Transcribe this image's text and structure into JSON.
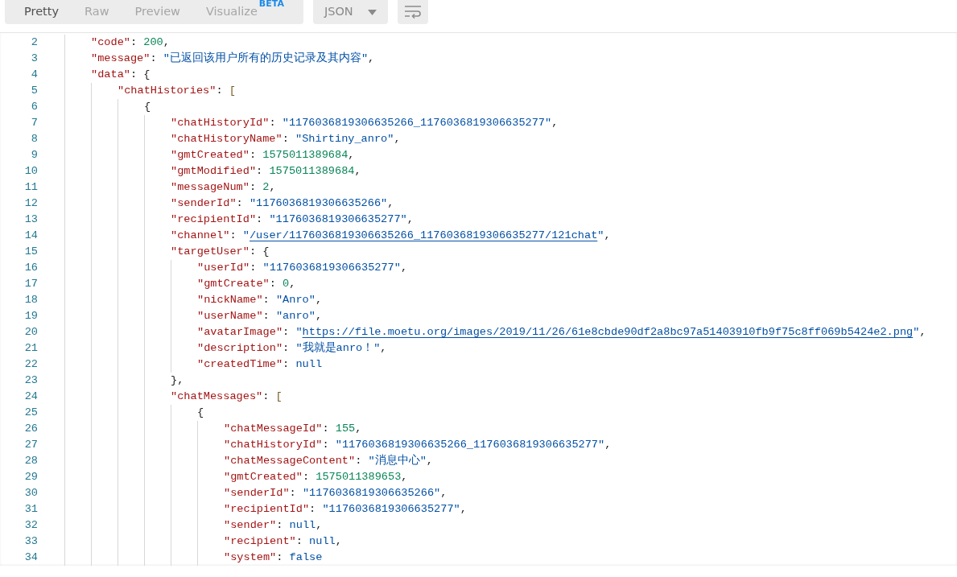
{
  "toolbar": {
    "tabs": [
      {
        "label": "Pretty",
        "selected": true
      },
      {
        "label": "Raw",
        "selected": false
      },
      {
        "label": "Preview",
        "selected": false
      },
      {
        "label": "Visualize",
        "selected": false,
        "badge": "BETA"
      }
    ],
    "format": "JSON"
  },
  "lines": [
    {
      "number": "2",
      "key": "\"code\"",
      "colon": ":",
      "value": "200",
      "kind": "number",
      "tail": ","
    },
    {
      "number": "3",
      "key": "\"message\"",
      "colon": ":",
      "value": "\"已返回该用户所有的历史记录及其内容\"",
      "kind": "string",
      "tail": ","
    },
    {
      "number": "4",
      "key": "\"data\"",
      "colon": ":",
      "value": "{",
      "kind": "punct",
      "children": [
        {
          "number": "5",
          "key": "\"chatHistories\"",
          "colon": ":",
          "value": "[",
          "kind": "bracket",
          "children": [
            {
              "number": "6",
              "value": "{",
              "kind": "punct",
              "children": [
                {
                  "number": "7",
                  "key": "\"chatHistoryId\"",
                  "colon": ":",
                  "value": "\"1176036819306635266_1176036819306635277\"",
                  "kind": "string",
                  "tail": ","
                },
                {
                  "number": "8",
                  "key": "\"chatHistoryName\"",
                  "colon": ":",
                  "value": "\"Shirtiny_anro\"",
                  "kind": "string",
                  "tail": ","
                },
                {
                  "number": "9",
                  "key": "\"gmtCreated\"",
                  "colon": ":",
                  "value": "1575011389684",
                  "kind": "number",
                  "tail": ","
                },
                {
                  "number": "10",
                  "key": "\"gmtModified\"",
                  "colon": ":",
                  "value": "1575011389684",
                  "kind": "number",
                  "tail": ","
                },
                {
                  "number": "11",
                  "key": "\"messageNum\"",
                  "colon": ":",
                  "value": "2",
                  "kind": "number",
                  "tail": ","
                },
                {
                  "number": "12",
                  "key": "\"senderId\"",
                  "colon": ":",
                  "value": "\"1176036819306635266\"",
                  "kind": "string",
                  "tail": ","
                },
                {
                  "number": "13",
                  "key": "\"recipientId\"",
                  "colon": ":",
                  "value": "\"1176036819306635277\"",
                  "kind": "string",
                  "tail": ","
                },
                {
                  "number": "14",
                  "key": "\"channel\"",
                  "colon": ":",
                  "value": "\"",
                  "link": "/user/1176036819306635266_1176036819306635277/121chat",
                  "value_end": "\"",
                  "kind": "link",
                  "tail": ","
                },
                {
                  "number": "15",
                  "key": "\"targetUser\"",
                  "colon": ":",
                  "value": "{",
                  "kind": "punct",
                  "children": [
                    {
                      "number": "16",
                      "key": "\"userId\"",
                      "colon": ":",
                      "value": "\"1176036819306635277\"",
                      "kind": "string",
                      "tail": ","
                    },
                    {
                      "number": "17",
                      "key": "\"gmtCreate\"",
                      "colon": ":",
                      "value": "0",
                      "kind": "number",
                      "tail": ","
                    },
                    {
                      "number": "18",
                      "key": "\"nickName\"",
                      "colon": ":",
                      "value": "\"Anro\"",
                      "kind": "string",
                      "tail": ","
                    },
                    {
                      "number": "19",
                      "key": "\"userName\"",
                      "colon": ":",
                      "value": "\"anro\"",
                      "kind": "string",
                      "tail": ","
                    },
                    {
                      "number": "20",
                      "key": "\"avatarImage\"",
                      "colon": ":",
                      "value": "\"",
                      "link": "https://file.moetu.org/images/2019/11/26/61e8cbde90df2a8bc97a51403910fb9f75c8ff069b5424e2.png",
                      "value_end": "\"",
                      "kind": "link",
                      "tail": ","
                    },
                    {
                      "number": "21",
                      "key": "\"description\"",
                      "colon": ":",
                      "value": "\"我就是anro！\"",
                      "kind": "string",
                      "tail": ","
                    },
                    {
                      "number": "22",
                      "key": "\"createdTime\"",
                      "colon": ":",
                      "value": "null",
                      "kind": "keyword"
                    }
                  ]
                },
                {
                  "number": "23",
                  "value": "}",
                  "kind": "punct",
                  "tail": ","
                },
                {
                  "number": "24",
                  "key": "\"chatMessages\"",
                  "colon": ":",
                  "value": "[",
                  "kind": "bracket",
                  "children": [
                    {
                      "number": "25",
                      "value": "{",
                      "kind": "punct",
                      "children": [
                        {
                          "number": "26",
                          "key": "\"chatMessageId\"",
                          "colon": ":",
                          "value": "155",
                          "kind": "number",
                          "tail": ","
                        },
                        {
                          "number": "27",
                          "key": "\"chatHistoryId\"",
                          "colon": ":",
                          "value": "\"1176036819306635266_1176036819306635277\"",
                          "kind": "string",
                          "tail": ","
                        },
                        {
                          "number": "28",
                          "key": "\"chatMessageContent\"",
                          "colon": ":",
                          "value": "\"消息中心\"",
                          "kind": "string",
                          "tail": ","
                        },
                        {
                          "number": "29",
                          "key": "\"gmtCreated\"",
                          "colon": ":",
                          "value": "1575011389653",
                          "kind": "number",
                          "tail": ","
                        },
                        {
                          "number": "30",
                          "key": "\"senderId\"",
                          "colon": ":",
                          "value": "\"1176036819306635266\"",
                          "kind": "string",
                          "tail": ","
                        },
                        {
                          "number": "31",
                          "key": "\"recipientId\"",
                          "colon": ":",
                          "value": "\"1176036819306635277\"",
                          "kind": "string",
                          "tail": ","
                        },
                        {
                          "number": "32",
                          "key": "\"sender\"",
                          "colon": ":",
                          "value": "null",
                          "kind": "keyword",
                          "tail": ","
                        },
                        {
                          "number": "33",
                          "key": "\"recipient\"",
                          "colon": ":",
                          "value": "null",
                          "kind": "keyword",
                          "tail": ","
                        },
                        {
                          "number": "34",
                          "key": "\"system\"",
                          "colon": ":",
                          "value": "false",
                          "kind": "keyword"
                        }
                      ]
                    }
                  ]
                }
              ]
            }
          ]
        }
      ]
    }
  ]
}
